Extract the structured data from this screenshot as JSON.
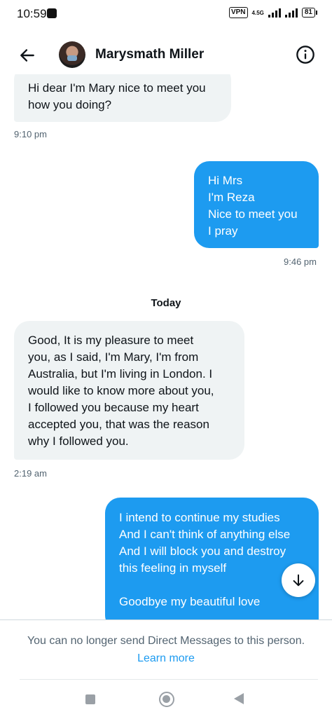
{
  "status_bar": {
    "time": "10:59",
    "vpn": "VPN",
    "network": "4.5G",
    "battery": "81"
  },
  "header": {
    "contact_name": "Marysmath Miller",
    "icons": {
      "back": "arrow-left-icon",
      "info": "info-circle-icon"
    }
  },
  "messages": [
    {
      "direction": "incoming",
      "text": "Hi dear I'm Mary nice to meet you\nhow you doing?",
      "time": "9:10 pm"
    },
    {
      "direction": "outgoing",
      "text": "Hi Mrs\nI'm Reza\nNice to meet you\nI pray",
      "time": "9:46 pm"
    },
    {
      "direction": "separator",
      "text": "Today"
    },
    {
      "direction": "incoming",
      "text": "Good, It is my pleasure to meet\nyou, as I said, I'm Mary, I'm from\nAustralia, but I'm living in London. I\nwould like to know more about you,\nI followed you because my heart\naccepted you, that was the reason\nwhy I followed you.",
      "time": "2:19 am"
    },
    {
      "direction": "outgoing",
      "text": "I intend to continue my studies\nAnd I can't think of anything else\nAnd I will block you and destroy\nthis feeling in myself\n\nGoodbye my beautiful love"
    }
  ],
  "footer": {
    "notice": "You can no longer send Direct Messages to this person.",
    "learn_more": "Learn more"
  },
  "colors": {
    "accent": "#1d9bf0",
    "incoming_bubble": "#eff3f4",
    "secondary_text": "#536471"
  }
}
